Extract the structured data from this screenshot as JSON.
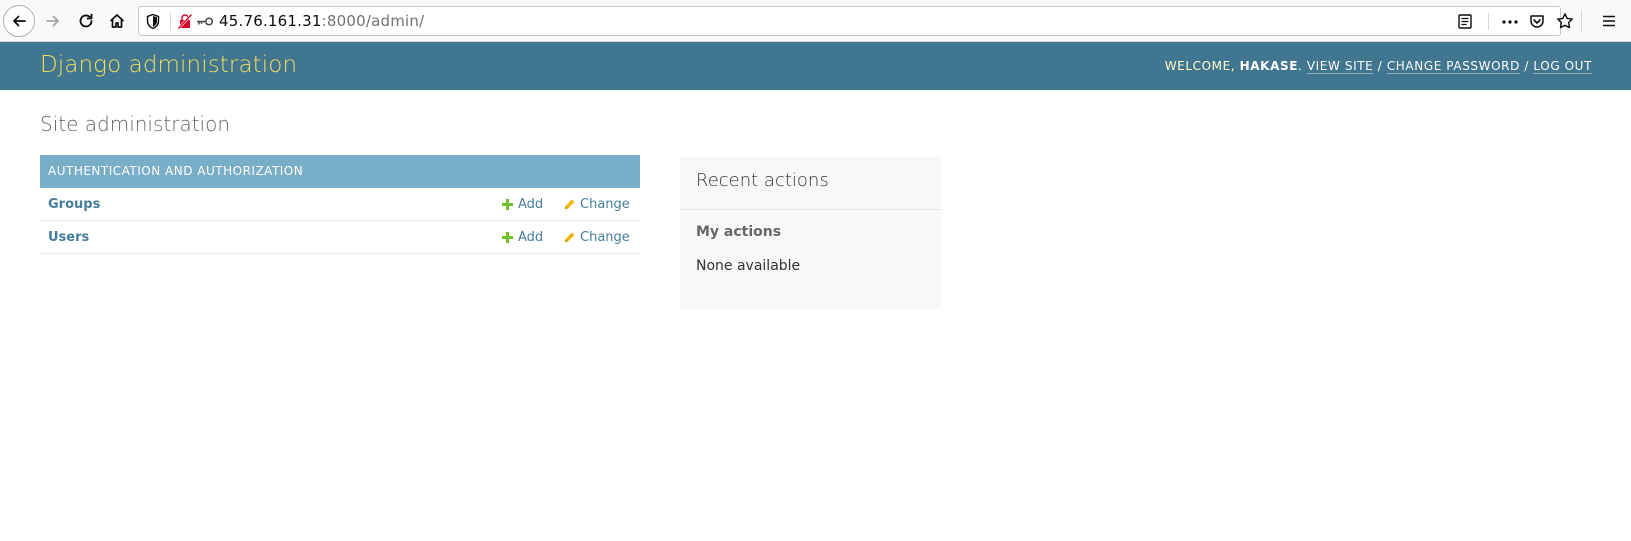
{
  "browser": {
    "url_host": "45.76.161.31",
    "url_rest": ":8000/admin/",
    "icons": {
      "back": "back-arrow-icon",
      "forward": "forward-arrow-icon",
      "reload": "reload-icon",
      "home": "home-icon",
      "shield": "tracking-shield-icon",
      "insecure": "insecure-connection-icon",
      "key": "key-icon",
      "reader": "reader-view-icon",
      "more": "more-actions-icon",
      "pocket": "pocket-icon",
      "star": "bookmark-star-icon",
      "menu": "hamburger-menu-icon"
    }
  },
  "header": {
    "branding": "Django administration",
    "welcome": "WELCOME,",
    "username": "HAKASE",
    "view_site": "VIEW SITE",
    "change_password": "CHANGE PASSWORD",
    "log_out": "LOG OUT",
    "separator": "/",
    "colors": {
      "bar": "#417690",
      "branding": "#f5dd5d"
    }
  },
  "content": {
    "title": "Site administration",
    "module": {
      "caption": "AUTHENTICATION AND AUTHORIZATION",
      "rows": [
        {
          "name": "Groups",
          "add": "Add",
          "change": "Change"
        },
        {
          "name": "Users",
          "add": "Add",
          "change": "Change"
        }
      ],
      "colors": {
        "caption_bg": "#79aec8",
        "link": "#447e9b",
        "add_icon": "#70bf2b",
        "change_icon": "#efb80b"
      }
    },
    "recent_actions": {
      "title": "Recent actions",
      "my_actions": "My actions",
      "none": "None available"
    }
  }
}
